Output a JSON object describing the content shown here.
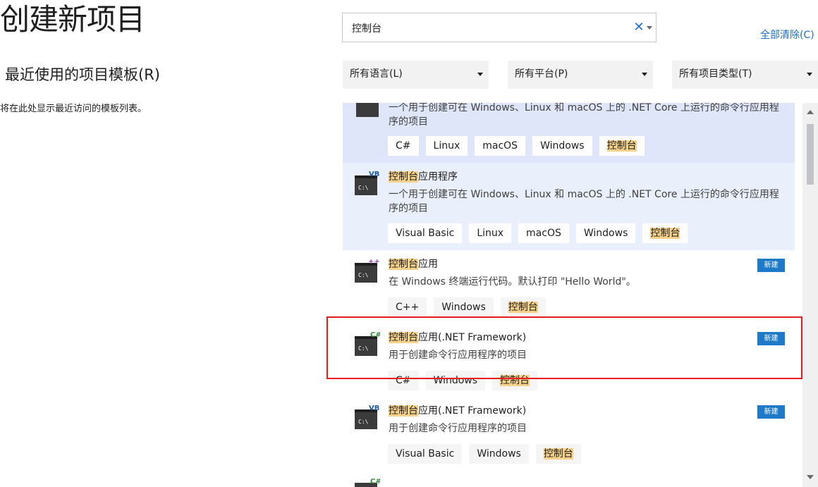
{
  "page_title": "创建新项目",
  "recent": {
    "title": "最近使用的项目模板(R)",
    "empty_text": "将在此处显示最近访问的模板列表。"
  },
  "search": {
    "value": "控制台",
    "clear_symbol": "✕"
  },
  "clear_all_label": "全部清除(C)",
  "filters": {
    "language": "所有语言(L)",
    "platform": "所有平台(P)",
    "project_type": "所有项目类型(T)"
  },
  "new_badge_label": "新建",
  "templates": [
    {
      "icon": "console-csharp-icon",
      "title_hl": "",
      "title_rest": "",
      "desc": "一个用于创建可在 Windows、Linux 和 macOS 上的 .NET Core 上运行的命令行应用程序的项目",
      "tags": [
        "C#",
        "Linux",
        "macOS",
        "Windows",
        "控制台"
      ]
    },
    {
      "icon": "console-vb-icon",
      "title_hl": "控制台",
      "title_rest": "应用程序",
      "desc": "一个用于创建可在 Windows、Linux 和 macOS 上的 .NET Core 上运行的命令行应用程序的项目",
      "tags": [
        "Visual Basic",
        "Linux",
        "macOS",
        "Windows",
        "控制台"
      ]
    },
    {
      "icon": "console-cpp-icon",
      "title_hl": "控制台",
      "title_rest": "应用",
      "desc": "在 Windows 终端运行代码。默认打印 \"Hello World\"。",
      "tags": [
        "C++",
        "Windows",
        "控制台"
      ]
    },
    {
      "icon": "console-csharp-icon",
      "title_hl": "控制台",
      "title_rest": "应用(.NET Framework)",
      "desc": "用于创建命令行应用程序的项目",
      "tags": [
        "C#",
        "Windows",
        "控制台"
      ]
    },
    {
      "icon": "console-vb-icon",
      "title_hl": "控制台",
      "title_rest": "应用(.NET Framework)",
      "desc": "用于创建命令行应用程序的项目",
      "tags": [
        "Visual Basic",
        "Windows",
        "控制台"
      ]
    }
  ],
  "colors": {
    "accent": "#1e79c9",
    "highlight": "#f6d18a",
    "selected_bg": "#dfe6f9",
    "annotation_red": "#e81c1c"
  }
}
